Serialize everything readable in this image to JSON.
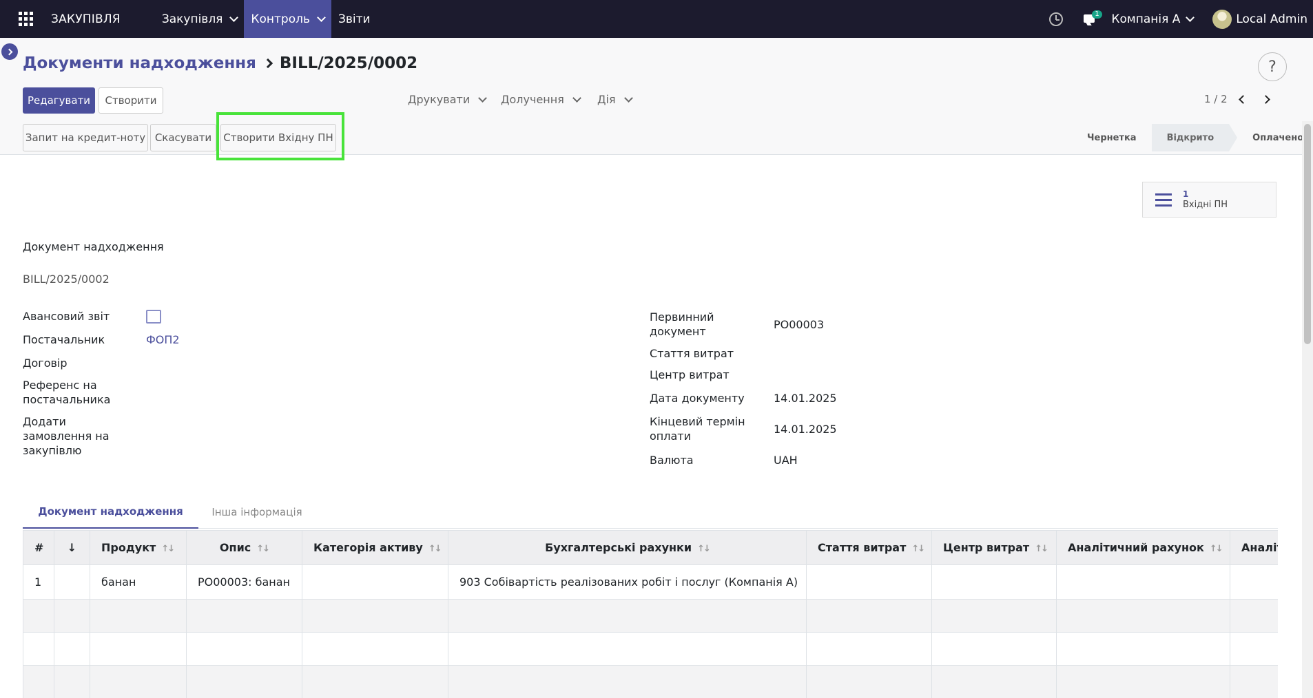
{
  "navbar": {
    "brand": "ЗАКУПІВЛЯ",
    "menus": [
      "Закупівля",
      "Контроль",
      "Звіти"
    ],
    "chat_badge": "1",
    "company": "Компанія А",
    "user": "Local Admin"
  },
  "breadcrumb": {
    "parent": "Документи надходження",
    "current": "BILL/2025/0002"
  },
  "toolbar": {
    "help": "?",
    "edit_label": "Редагувати",
    "create_label": "Створити",
    "print_label": "Друкувати",
    "attach_label": "Долучення",
    "action_label": "Дія",
    "pager": "1 / 2"
  },
  "status_buttons": {
    "credit_note": "Запит на кредит-ноту",
    "cancel": "Скасувати",
    "create_incoming": "Створити Вхідну ПН"
  },
  "status_steps": [
    "Чернетка",
    "Відкрито",
    "Оплачено"
  ],
  "smart_button": {
    "count": "1",
    "label": "Вхідні ПН"
  },
  "form": {
    "doc_type": "Документ надходження",
    "doc_number": "BILL/2025/0002",
    "left": {
      "advance_label": "Авансовий звіт",
      "vendor_label": "Постачальник",
      "vendor_value": "ФОП2",
      "contract_label": "Договір",
      "vendor_ref_label": "Референс на постачальника",
      "add_po_label": "Додати замовлення на закупівлю"
    },
    "right": {
      "source_doc_label": "Первинний документ",
      "source_doc_value": "PO00003",
      "expense_label": "Стаття витрат",
      "cost_center_label": "Центр витрат",
      "doc_date_label": "Дата документу",
      "doc_date_value": "14.01.2025",
      "due_date_label": "Кінцевий термін оплати",
      "due_date_value": "14.01.2025",
      "currency_label": "Валюта",
      "currency_value": "UAH"
    }
  },
  "tabs": [
    "Документ надходження",
    "Інша інформація"
  ],
  "table": {
    "headers": [
      "#",
      "↓",
      "Продукт",
      "Опис",
      "Категорія активу",
      "Бухгалтерські рахунки",
      "Стаття витрат",
      "Центр витрат",
      "Аналітичний рахунок",
      "Аналітика"
    ],
    "rows": [
      [
        "1",
        "",
        "банан",
        "PO00003: банан",
        "",
        "903 Собівартість реалізованих робіт і послуг (Компанія А)",
        "",
        "",
        "",
        ""
      ]
    ]
  }
}
